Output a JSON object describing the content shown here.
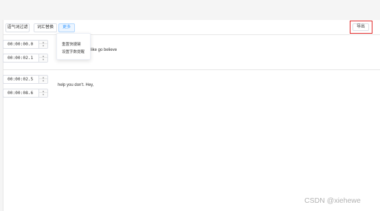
{
  "toolbar": {
    "btn1": "语气词过滤",
    "btn2": "词汇替换",
    "btn3": "更多",
    "export": "导出"
  },
  "dropdown": {
    "item1": "重置快捷键",
    "item2": "设置字数提醒"
  },
  "rows": [
    {
      "start": "00:00:00.0",
      "end": "00:00:02.1",
      "text": "like go believe"
    },
    {
      "start": "00:00:02.5",
      "end": "00:00:08.6",
      "text": "help you don't. Hey,"
    }
  ],
  "stepper": {
    "up": "▲",
    "down": "▼"
  },
  "watermark": "CSDN @xiehewe"
}
